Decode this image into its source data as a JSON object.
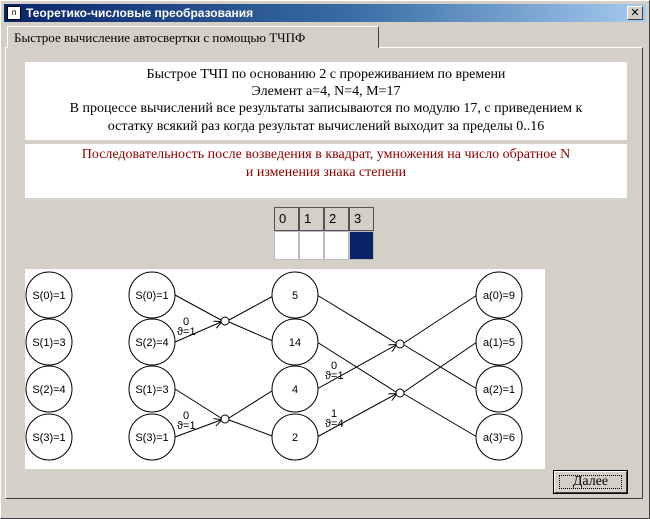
{
  "window": {
    "title": "Теоретико-числовые преобразования",
    "app_icon_glyph": "п",
    "close_glyph": "✕"
  },
  "tabs": [
    {
      "label": "Быстрое вычисление автосвертки с помощью ТЧПФ"
    }
  ],
  "info": {
    "line1": "Быстрое ТЧП по основанию 2 с прореживанием по времени",
    "line2": "Элемент a=4, N=4, M=17",
    "line3": "В процессе вычислений все результаты записываются по модулю 17, с приведением к",
    "line4": "остатку всякий раз когда результат вычислений выходит за пределы 0..16",
    "red_line1": "Последовательность после возведения в квадрат, умножения на число обратное N",
    "red_line2": "и изменения знака степени",
    "red_color": "#8b0000"
  },
  "index_grid": {
    "headers": [
      "0",
      "1",
      "2",
      "3"
    ],
    "selected_index": 3,
    "selected_color": "#0a246a"
  },
  "diagram": {
    "input_nodes": [
      "S(0)=1",
      "S(1)=3",
      "S(2)=4",
      "S(3)=1"
    ],
    "reordered_nodes": [
      "S(0)=1",
      "S(2)=4",
      "S(1)=3",
      "S(3)=1"
    ],
    "stage1_nodes": [
      "5",
      "14",
      "4",
      "2"
    ],
    "output_nodes": [
      "a(0)=9",
      "a(1)=5",
      "a(2)=1",
      "a(3)=6"
    ],
    "twiddles": [
      {
        "exp": "0",
        "sym": "ϑ=1"
      },
      {
        "exp": "0",
        "sym": "ϑ=1"
      },
      {
        "exp": "0",
        "sym": "ϑ=1"
      },
      {
        "exp": "1",
        "sym": "ϑ=4"
      }
    ]
  },
  "buttons": {
    "next_label": "Далее"
  }
}
